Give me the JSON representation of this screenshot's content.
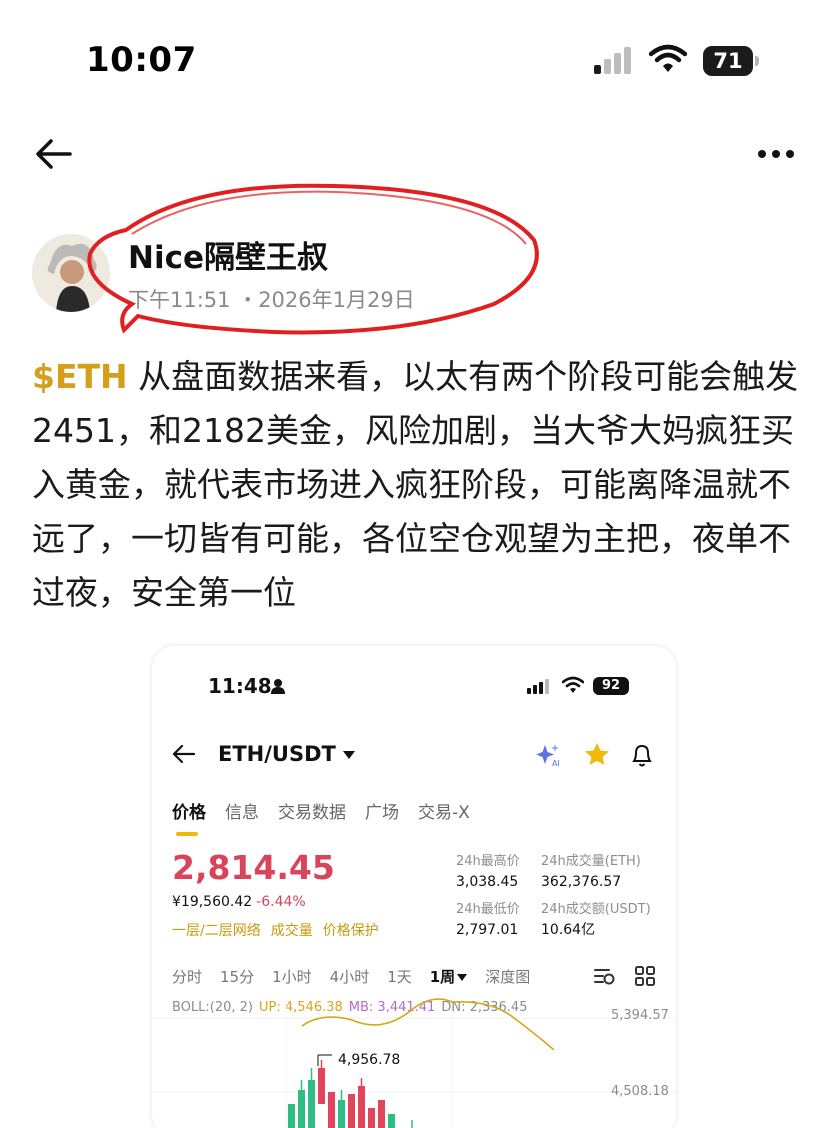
{
  "status_bar": {
    "time": "10:07",
    "battery": "71"
  },
  "post": {
    "author": "Nice隔壁王叔",
    "time": "下午11:51 ・2026年1月29日",
    "ticker": "$ETH",
    "body": " 从盘面数据来看，以太有两个阶段可能会触发2451，和2182美金，风险加剧，当大爷大妈疯狂买入黄金，就代表市场进入疯狂阶段，可能离降温就不远了，一切皆有可能，各位空仓观望为主把，夜单不过夜，安全第一位"
  },
  "embedded": {
    "status_time": "11:48",
    "battery": "92",
    "pair": "ETH/USDT",
    "tabs": [
      "价格",
      "信息",
      "交易数据",
      "广场",
      "交易-X"
    ],
    "price": "2,814.45",
    "fiat_price": "¥19,560.42",
    "change": "-6.44%",
    "links": [
      "一层/二层网络",
      "成交量",
      "价格保护"
    ],
    "stats": {
      "high_label": "24h最高价",
      "high": "3,038.45",
      "vol_eth_label": "24h成交量(ETH)",
      "vol_eth": "362,376.57",
      "low_label": "24h最低价",
      "low": "2,797.01",
      "vol_usdt_label": "24h成交额(USDT)",
      "vol_usdt": "10.64亿"
    },
    "timeframes": [
      "分时",
      "15分",
      "1小时",
      "4小时",
      "1天",
      "1周",
      "深度图"
    ],
    "active_timeframe": "1周",
    "boll": {
      "label": "BOLL:(20, 2)",
      "up": "UP: 4,546.38",
      "mb": "MB: 3,441.41",
      "dn": "DN: 2,336.45"
    },
    "axis": [
      "5,394.57",
      "4,508.18"
    ],
    "peak": "4,956.78",
    "colors": {
      "up": "#2ebd85",
      "down": "#e0455c",
      "accent": "#f0b90b",
      "mb_line": "#d6a61c"
    }
  },
  "icons": [
    "back-arrow-icon",
    "more-icon",
    "signal-icon",
    "wifi-icon",
    "battery-icon",
    "star-icon",
    "bell-icon",
    "ai-sparkle-icon"
  ]
}
